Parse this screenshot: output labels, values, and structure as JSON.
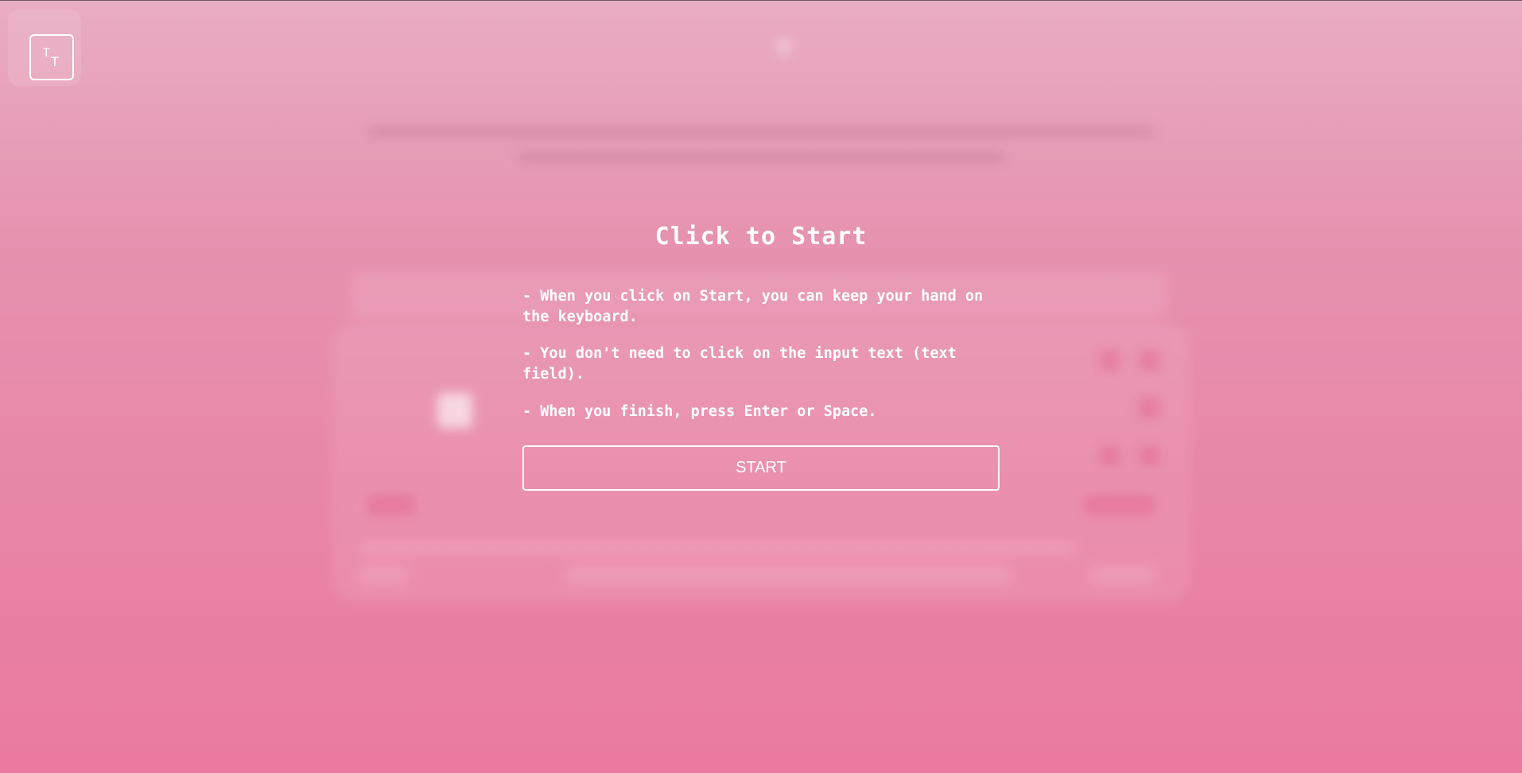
{
  "logo": {
    "glyph_top": "T",
    "glyph_bottom": "T"
  },
  "overlay": {
    "title": "Click to Start",
    "instructions": [
      "- When you click on Start, you can keep your hand on the keyboard.",
      "- You don't need to click on the input text (text field).",
      "- When you finish, press Enter or Space."
    ],
    "start_button": "START"
  },
  "colors": {
    "background_top": "#e9adc3",
    "background_bottom": "#ea7aa0",
    "text": "#ffffff"
  }
}
